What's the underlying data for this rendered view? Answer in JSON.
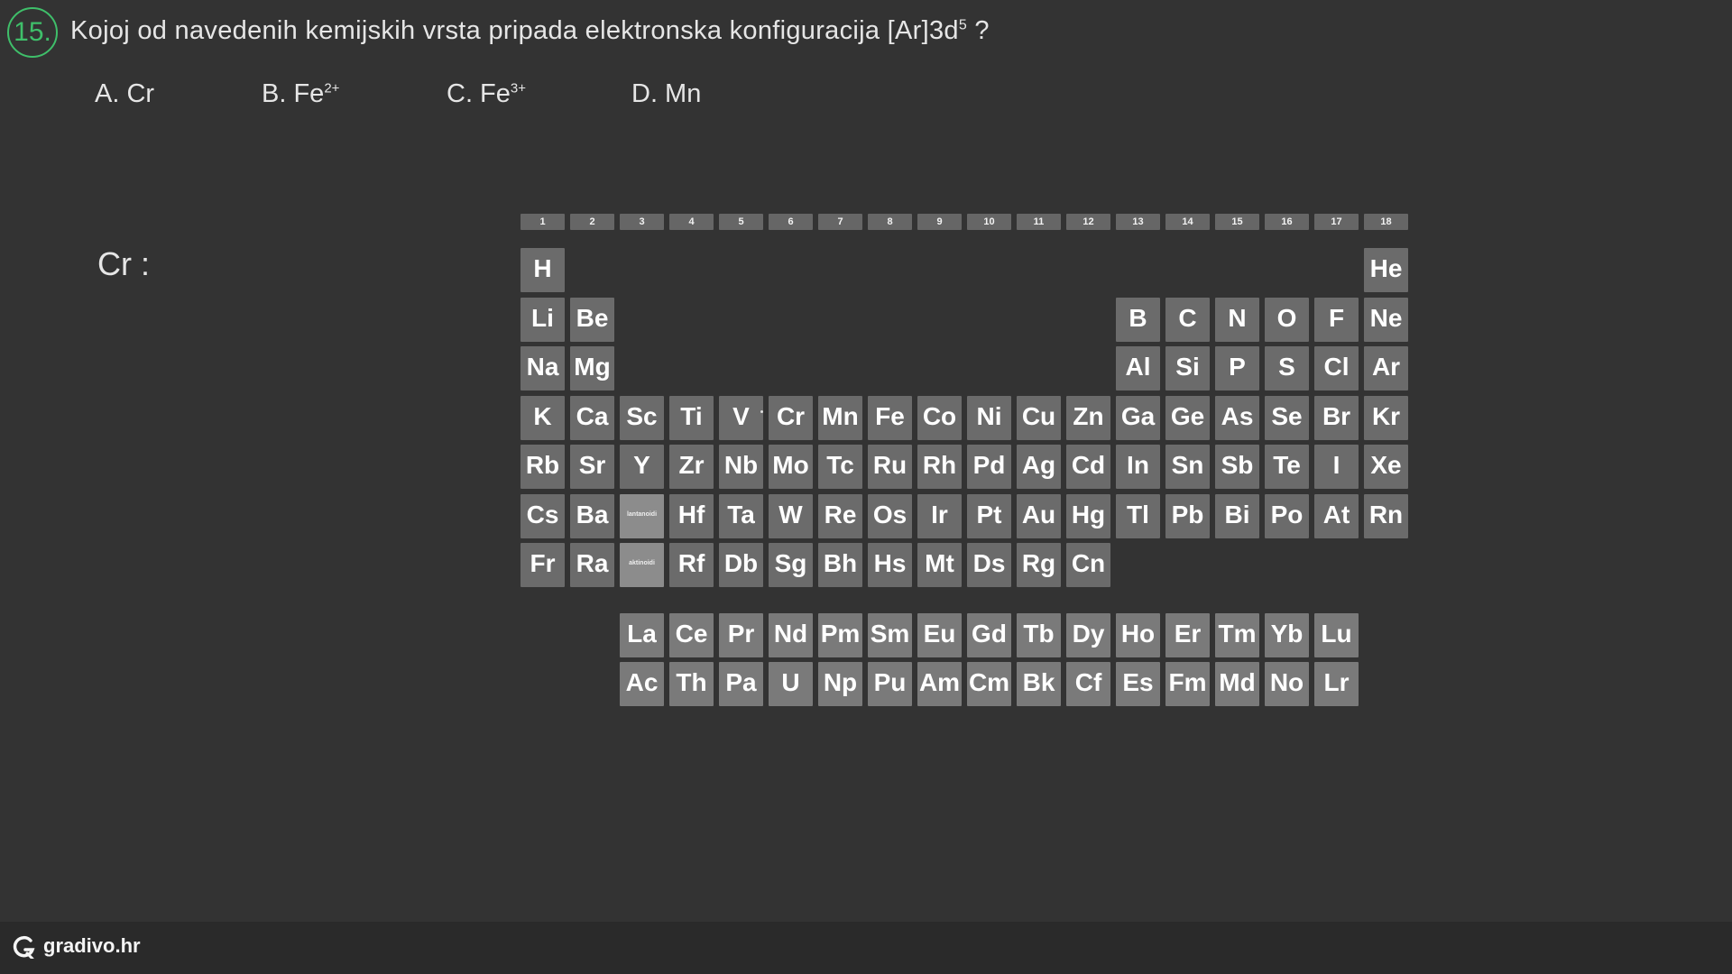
{
  "question": {
    "number": "15.",
    "text_before": "Kojoj od navedenih kemijskih vrsta pripada elektronska konfiguracija [Ar]3d",
    "superscript": "5",
    "text_after": " ?"
  },
  "answers": [
    {
      "label": "A. Cr",
      "charge": ""
    },
    {
      "label": "B. Fe",
      "charge": "2+"
    },
    {
      "label": "C. Fe",
      "charge": "3+"
    },
    {
      "label": "D. Mn",
      "charge": ""
    }
  ],
  "work_note": "Cr :",
  "periodic_table": {
    "groups": [
      "1",
      "2",
      "3",
      "4",
      "5",
      "6",
      "7",
      "8",
      "9",
      "10",
      "11",
      "12",
      "13",
      "14",
      "15",
      "16",
      "17",
      "18"
    ],
    "placeholder_labels": {
      "lanthanides": "lantanoidi",
      "actinides": "aktinoidi"
    },
    "elements": [
      {
        "sym": "H",
        "g": 1,
        "p": 1
      },
      {
        "sym": "He",
        "g": 18,
        "p": 1
      },
      {
        "sym": "Li",
        "g": 1,
        "p": 2
      },
      {
        "sym": "Be",
        "g": 2,
        "p": 2
      },
      {
        "sym": "B",
        "g": 13,
        "p": 2
      },
      {
        "sym": "C",
        "g": 14,
        "p": 2
      },
      {
        "sym": "N",
        "g": 15,
        "p": 2
      },
      {
        "sym": "O",
        "g": 16,
        "p": 2
      },
      {
        "sym": "F",
        "g": 17,
        "p": 2
      },
      {
        "sym": "Ne",
        "g": 18,
        "p": 2
      },
      {
        "sym": "Na",
        "g": 1,
        "p": 3
      },
      {
        "sym": "Mg",
        "g": 2,
        "p": 3
      },
      {
        "sym": "Al",
        "g": 13,
        "p": 3
      },
      {
        "sym": "Si",
        "g": 14,
        "p": 3
      },
      {
        "sym": "P",
        "g": 15,
        "p": 3
      },
      {
        "sym": "S",
        "g": 16,
        "p": 3
      },
      {
        "sym": "Cl",
        "g": 17,
        "p": 3
      },
      {
        "sym": "Ar",
        "g": 18,
        "p": 3
      },
      {
        "sym": "K",
        "g": 1,
        "p": 4
      },
      {
        "sym": "Ca",
        "g": 2,
        "p": 4
      },
      {
        "sym": "Sc",
        "g": 3,
        "p": 4
      },
      {
        "sym": "Ti",
        "g": 4,
        "p": 4
      },
      {
        "sym": "V",
        "g": 5,
        "p": 4
      },
      {
        "sym": "Cr",
        "g": 6,
        "p": 4
      },
      {
        "sym": "Mn",
        "g": 7,
        "p": 4
      },
      {
        "sym": "Fe",
        "g": 8,
        "p": 4
      },
      {
        "sym": "Co",
        "g": 9,
        "p": 4
      },
      {
        "sym": "Ni",
        "g": 10,
        "p": 4
      },
      {
        "sym": "Cu",
        "g": 11,
        "p": 4
      },
      {
        "sym": "Zn",
        "g": 12,
        "p": 4
      },
      {
        "sym": "Ga",
        "g": 13,
        "p": 4
      },
      {
        "sym": "Ge",
        "g": 14,
        "p": 4
      },
      {
        "sym": "As",
        "g": 15,
        "p": 4
      },
      {
        "sym": "Se",
        "g": 16,
        "p": 4
      },
      {
        "sym": "Br",
        "g": 17,
        "p": 4
      },
      {
        "sym": "Kr",
        "g": 18,
        "p": 4
      },
      {
        "sym": "Rb",
        "g": 1,
        "p": 5
      },
      {
        "sym": "Sr",
        "g": 2,
        "p": 5
      },
      {
        "sym": "Y",
        "g": 3,
        "p": 5
      },
      {
        "sym": "Zr",
        "g": 4,
        "p": 5
      },
      {
        "sym": "Nb",
        "g": 5,
        "p": 5
      },
      {
        "sym": "Mo",
        "g": 6,
        "p": 5
      },
      {
        "sym": "Tc",
        "g": 7,
        "p": 5
      },
      {
        "sym": "Ru",
        "g": 8,
        "p": 5
      },
      {
        "sym": "Rh",
        "g": 9,
        "p": 5
      },
      {
        "sym": "Pd",
        "g": 10,
        "p": 5
      },
      {
        "sym": "Ag",
        "g": 11,
        "p": 5
      },
      {
        "sym": "Cd",
        "g": 12,
        "p": 5
      },
      {
        "sym": "In",
        "g": 13,
        "p": 5
      },
      {
        "sym": "Sn",
        "g": 14,
        "p": 5
      },
      {
        "sym": "Sb",
        "g": 15,
        "p": 5
      },
      {
        "sym": "Te",
        "g": 16,
        "p": 5
      },
      {
        "sym": "I",
        "g": 17,
        "p": 5
      },
      {
        "sym": "Xe",
        "g": 18,
        "p": 5
      },
      {
        "sym": "Cs",
        "g": 1,
        "p": 6
      },
      {
        "sym": "Ba",
        "g": 2,
        "p": 6
      },
      {
        "sym": "Hf",
        "g": 4,
        "p": 6
      },
      {
        "sym": "Ta",
        "g": 5,
        "p": 6
      },
      {
        "sym": "W",
        "g": 6,
        "p": 6
      },
      {
        "sym": "Re",
        "g": 7,
        "p": 6
      },
      {
        "sym": "Os",
        "g": 8,
        "p": 6
      },
      {
        "sym": "Ir",
        "g": 9,
        "p": 6
      },
      {
        "sym": "Pt",
        "g": 10,
        "p": 6
      },
      {
        "sym": "Au",
        "g": 11,
        "p": 6
      },
      {
        "sym": "Hg",
        "g": 12,
        "p": 6
      },
      {
        "sym": "Tl",
        "g": 13,
        "p": 6
      },
      {
        "sym": "Pb",
        "g": 14,
        "p": 6
      },
      {
        "sym": "Bi",
        "g": 15,
        "p": 6
      },
      {
        "sym": "Po",
        "g": 16,
        "p": 6
      },
      {
        "sym": "At",
        "g": 17,
        "p": 6
      },
      {
        "sym": "Rn",
        "g": 18,
        "p": 6
      },
      {
        "sym": "Fr",
        "g": 1,
        "p": 7
      },
      {
        "sym": "Ra",
        "g": 2,
        "p": 7
      },
      {
        "sym": "Rf",
        "g": 4,
        "p": 7
      },
      {
        "sym": "Db",
        "g": 5,
        "p": 7
      },
      {
        "sym": "Sg",
        "g": 6,
        "p": 7
      },
      {
        "sym": "Bh",
        "g": 7,
        "p": 7
      },
      {
        "sym": "Hs",
        "g": 8,
        "p": 7
      },
      {
        "sym": "Mt",
        "g": 9,
        "p": 7
      },
      {
        "sym": "Ds",
        "g": 10,
        "p": 7
      },
      {
        "sym": "Rg",
        "g": 11,
        "p": 7
      },
      {
        "sym": "Cn",
        "g": 12,
        "p": 7
      }
    ],
    "lanthanides": [
      "La",
      "Ce",
      "Pr",
      "Nd",
      "Pm",
      "Sm",
      "Eu",
      "Gd",
      "Tb",
      "Dy",
      "Ho",
      "Er",
      "Tm",
      "Yb",
      "Lu"
    ],
    "actinides": [
      "Ac",
      "Th",
      "Pa",
      "U",
      "Np",
      "Pu",
      "Am",
      "Cm",
      "Bk",
      "Cf",
      "Es",
      "Fm",
      "Md",
      "No",
      "Lr"
    ],
    "colors": {
      "cell": "#6b6b6b",
      "f_block": "#7a7a7a",
      "placeholder": "#8c8c8c",
      "group_header": "#666666"
    }
  },
  "footer": {
    "brand": "gradivo.hr"
  },
  "accent_color": "#3fbf6a"
}
